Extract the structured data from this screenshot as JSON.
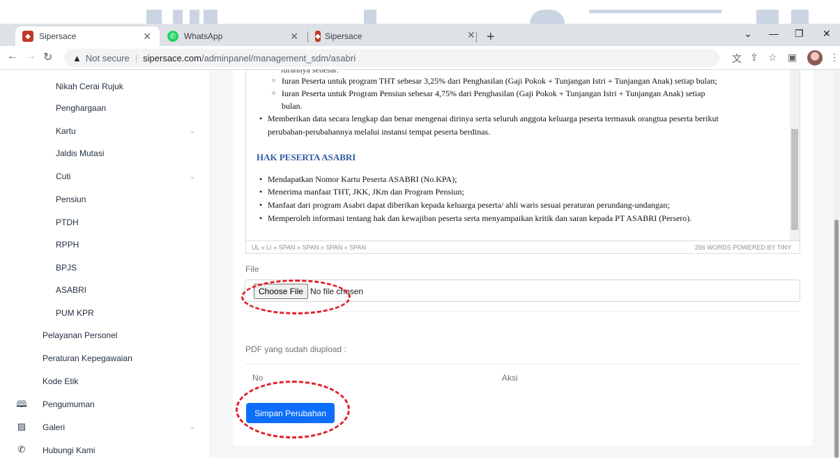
{
  "browser": {
    "tabs": [
      {
        "title": "Sipersace",
        "favicon_color": "#c0392b"
      },
      {
        "title": "WhatsApp",
        "favicon_color": "#25d366"
      },
      {
        "title": "Sipersace",
        "favicon_color": "#c0392b"
      }
    ],
    "new_tab": "+",
    "address": {
      "security": "Not secure",
      "host": "sipersace.com",
      "path": "/adminpanel/management_sdm/asabri"
    }
  },
  "sidebar": {
    "items": [
      {
        "label": "Nikah Cerai Rujuk"
      },
      {
        "label": "Penghargaan"
      },
      {
        "label": "Kartu",
        "has_submenu": true
      },
      {
        "label": "Jaldis Mutasi"
      },
      {
        "label": "Cuti",
        "has_submenu": true
      },
      {
        "label": "Pensiun"
      },
      {
        "label": "PTDH"
      },
      {
        "label": "RPPH"
      },
      {
        "label": "BPJS"
      },
      {
        "label": "ASABRI"
      },
      {
        "label": "PUM KPR"
      }
    ],
    "sections": [
      {
        "label": "Pelayanan Personel"
      },
      {
        "label": "Peraturan Kepegawaian"
      },
      {
        "label": "Kode Etik"
      }
    ],
    "top": [
      {
        "label": "Pengumuman",
        "icon": "book-icon"
      },
      {
        "label": "Galeri",
        "icon": "image-icon",
        "has_submenu": true
      },
      {
        "label": "Hubungi Kami",
        "icon": "phone-icon"
      }
    ]
  },
  "editor": {
    "cut_line": "iurannya sebesar:",
    "sub_bullets": [
      "Iuran Peserta untuk program THT sebesar 3,25% dari Penghasilan (Gaji Pokok + Tunjangan Istri + Tunjangan Anak) setiap bulan;",
      "Iuran Peserta untuk Program Pensiun sebesar 4,75% dari Penghasilan (Gaji Pokok + Tunjangan Istri + Tunjangan Anak) setiap",
      "bulan."
    ],
    "bullet_a1": "Memberikan data secara lengkap dan benar mengenai dirinya serta seluruh anggota keluarga peserta termasuk orangtua peserta berikut",
    "bullet_a2": "perubahan-perubahannya melalui instansi tempat peserta berdinas.",
    "heading": "HAK PESERTA ASABRI",
    "rights": [
      "Mendapatkan Nomor Kartu Peserta ASABRI (No.KPA);",
      "Menerima manfaat THT, JKK, JKm dan Program Pensiun;",
      "Manfaat dari program Asabri dapat diberikan kepada keluarga peserta/ ahli waris sesuai peraturan perundang-undangan;",
      "Memperoleh informasi tentang hak dan kewajiban peserta serta menyampaikan kritik dan saran kepada PT ASABRI (Persero)."
    ],
    "path": "UL » LI » SPAN » SPAN » SPAN » SPAN",
    "stats": "256 WORDS  POWERED BY TINY"
  },
  "form": {
    "file_label": "File",
    "choose_button": "Choose File",
    "no_file": "No file chosen",
    "uploaded_label": "PDF yang sudah diupload :",
    "col_no": "No",
    "col_aksi": "Aksi",
    "submit": "Simpan Perubahan"
  },
  "colors": {
    "primary": "#0d6efd",
    "highlight": "#e0202a",
    "heading": "#2d5aa0"
  }
}
